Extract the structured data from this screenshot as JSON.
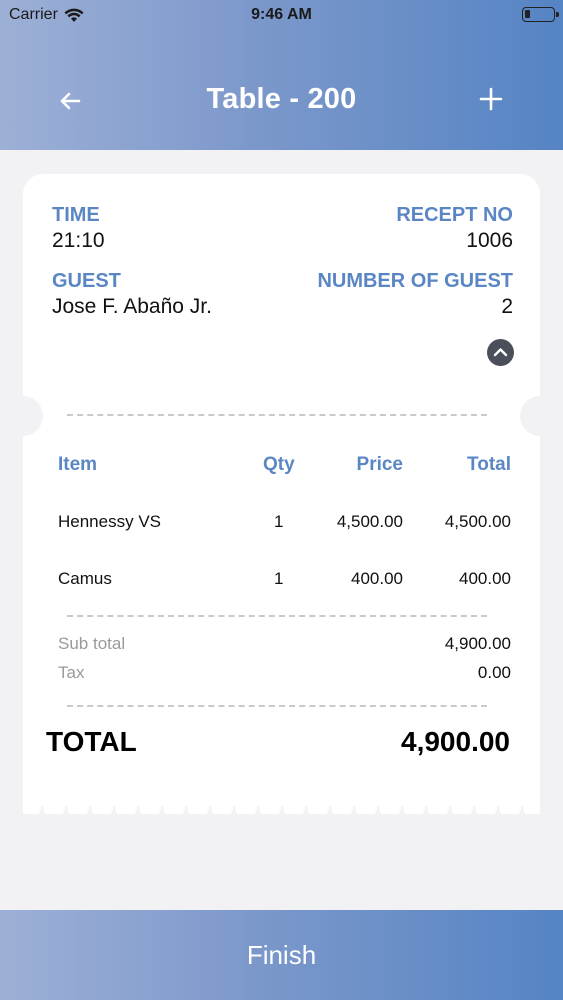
{
  "status_bar": {
    "carrier": "Carrier",
    "time": "9:46 AM"
  },
  "nav": {
    "title": "Table - 200",
    "back_icon": "arrow-left-icon",
    "add_icon": "plus-icon"
  },
  "info": {
    "time_label": "TIME",
    "time_value": "21:10",
    "receipt_label": "RECEPT NO",
    "receipt_value": "1006",
    "guest_label": "GUEST",
    "guest_value": "Jose F. Abaño Jr.",
    "guest_count_label": "NUMBER OF GUEST",
    "guest_count_value": "2"
  },
  "table": {
    "headers": {
      "item": "Item",
      "qty": "Qty",
      "price": "Price",
      "total": "Total"
    },
    "rows": [
      {
        "item": "Hennessy VS",
        "qty": "1",
        "price": "4,500.00",
        "total": "4,500.00"
      },
      {
        "item": "Camus",
        "qty": "1",
        "price": "400.00",
        "total": "400.00"
      }
    ]
  },
  "summary": {
    "subtotal_label": "Sub total",
    "subtotal_value": "4,900.00",
    "tax_label": "Tax",
    "tax_value": "0.00",
    "total_label": "TOTAL",
    "total_value": "4,900.00"
  },
  "footer": {
    "finish_label": "Finish"
  },
  "colors": {
    "accent_blue": "#5b86c4",
    "header_gradient_start": "#9db0d6",
    "header_gradient_end": "#5584c4"
  }
}
